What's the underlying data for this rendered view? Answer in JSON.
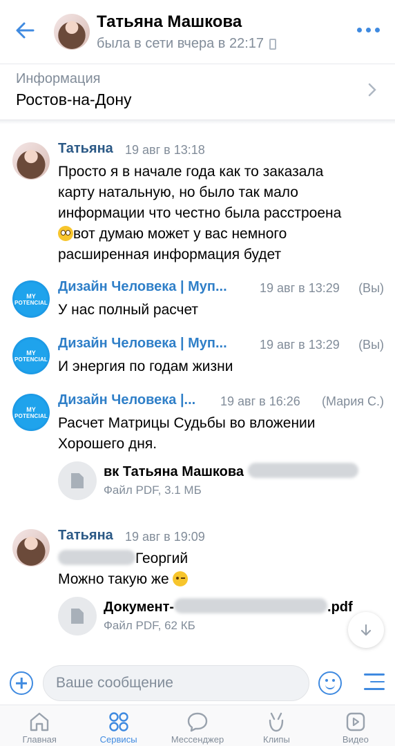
{
  "header": {
    "name": "Татьяна Машкова",
    "status": "была в сети вчера в 22:17"
  },
  "info": {
    "label": "Информация",
    "value": "Ростов-на-Дону"
  },
  "messages": [
    {
      "author": "Татьяна",
      "time": "19 авг в 13:18",
      "lines": [
        "Просто я в начале года как то заказала",
        "карту натальную, но было так мало",
        "информации что честно была расстроена",
        "вот думаю может у вас немного",
        "расширенная информация будет"
      ]
    },
    {
      "author": "Дизайн Человека | Myп...",
      "time": "19 авг в 13:29",
      "sender_note": "(Вы)",
      "text": "У нас полный расчет"
    },
    {
      "author": "Дизайн Человека | Myп...",
      "time": "19 авг в 13:29",
      "sender_note": "(Вы)",
      "text": "И энергия по годам жизни"
    },
    {
      "author": "Дизайн Человека |...",
      "time": "19 авг в 16:26",
      "sender_note": "(Мария С.)",
      "lines": [
        "Расчет Матрицы Судьбы во вложении",
        "Хорошего дня."
      ],
      "attachment": {
        "name": "вк Татьяна Машкова",
        "meta": "Файл PDF, 3.1 МБ"
      }
    },
    {
      "author": "Татьяна",
      "time": "19 авг в 19:09",
      "line1": "Георгий",
      "line2": "Можно такую же",
      "attachment": {
        "name_prefix": "Документ-",
        "name_suffix": ".pdf",
        "meta": "Файл PDF, 62 КБ"
      }
    }
  ],
  "brand_avatar": {
    "top": "MY",
    "bottom": "POTENCIAL"
  },
  "composer": {
    "placeholder": "Ваше сообщение"
  },
  "tabs": [
    {
      "label": "Главная",
      "icon": "home-icon"
    },
    {
      "label": "Сервисы",
      "icon": "services-icon"
    },
    {
      "label": "Мессенджер",
      "icon": "messenger-icon"
    },
    {
      "label": "Клипы",
      "icon": "clips-icon"
    },
    {
      "label": "Видео",
      "icon": "video-icon"
    }
  ],
  "colors": {
    "accent": "#3f8ae0",
    "author": "#2a5885",
    "muted": "#818c99"
  }
}
